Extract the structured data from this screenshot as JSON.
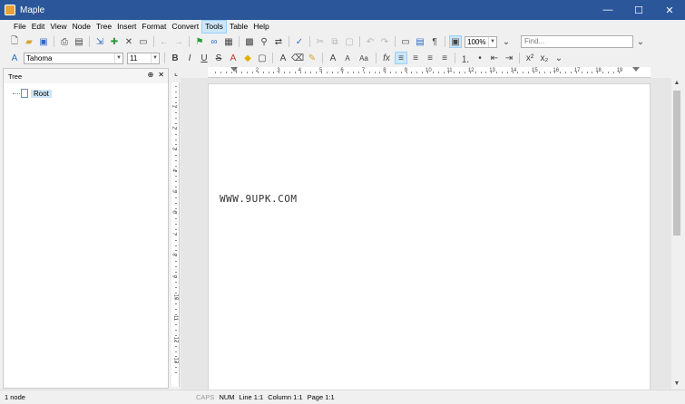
{
  "window": {
    "title": "Maple",
    "controls": [
      "—",
      "☐",
      "✕"
    ]
  },
  "menu": [
    "File",
    "Edit",
    "View",
    "Node",
    "Tree",
    "Insert",
    "Format",
    "Convert",
    "Tools",
    "Table",
    "Help"
  ],
  "toolbar": {
    "zoom": "100%",
    "find_placeholder": "Find...",
    "font_name": "Tahoma",
    "font_size": "11"
  },
  "tree": {
    "title": "Tree",
    "pin": "⊕",
    "close": "✕",
    "root_label": "Root"
  },
  "ruler": {
    "h_numbers": [
      "1",
      "2",
      "3",
      "4",
      "5",
      "6",
      "7",
      "8",
      "9",
      "10",
      "11",
      "12",
      "13",
      "14",
      "15",
      "16",
      "17",
      "18",
      "19"
    ],
    "v_numbers": [
      "1",
      "2",
      "3",
      "4",
      "5",
      "6",
      "7",
      "8",
      "9",
      "10",
      "11",
      "12",
      "13"
    ]
  },
  "document": {
    "text": "WWW.9UPK.COM"
  },
  "status": {
    "nodes": "1 node",
    "caps": "CAPS",
    "num": "NUM",
    "line": "Line 1:1",
    "column": "Column 1:1",
    "page": "Page 1:1"
  }
}
